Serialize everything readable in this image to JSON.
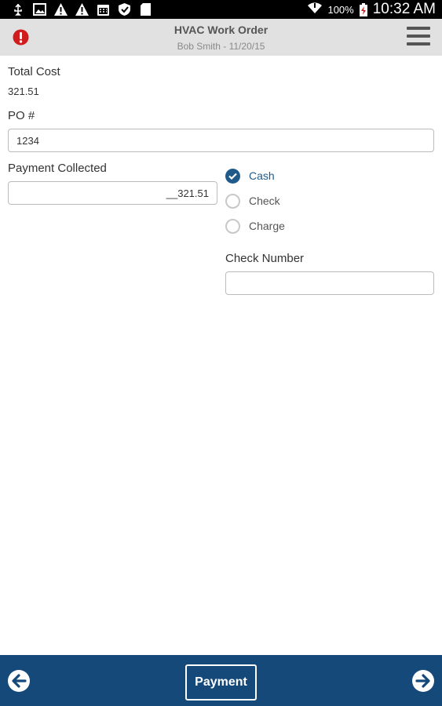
{
  "status_bar": {
    "left_icons": [
      "usb-icon",
      "image-icon",
      "warning-icon",
      "warning-icon",
      "calendar-icon",
      "shield-icon",
      "sd-card-icon"
    ],
    "wifi_icon": "wifi-icon",
    "battery_text": "100%",
    "battery_icon": "battery-charging-icon",
    "time": "10:32 AM"
  },
  "header": {
    "alert_icon": "alert-icon",
    "title": "HVAC Work Order",
    "subtitle": "Bob Smith - 11/20/15",
    "menu_icon": "hamburger-menu-icon"
  },
  "form": {
    "total_cost_label": "Total Cost",
    "total_cost_value": "321.51",
    "po_label": "PO #",
    "po_value": "1234",
    "payment_collected_label": "Payment Collected",
    "payment_collected_value": "__321.51",
    "payment_methods": [
      {
        "label": "Cash",
        "selected": true
      },
      {
        "label": "Check",
        "selected": false
      },
      {
        "label": "Charge",
        "selected": false
      }
    ],
    "check_number_label": "Check Number",
    "check_number_value": ""
  },
  "bottom_bar": {
    "back_icon": "arrow-left-icon",
    "button_label": "Payment",
    "forward_icon": "arrow-right-icon"
  },
  "colors": {
    "accent": "#15497a",
    "selected_radio": "#1f5a8a",
    "alert": "#d01c1c",
    "header_bg": "#e1e1e1"
  }
}
